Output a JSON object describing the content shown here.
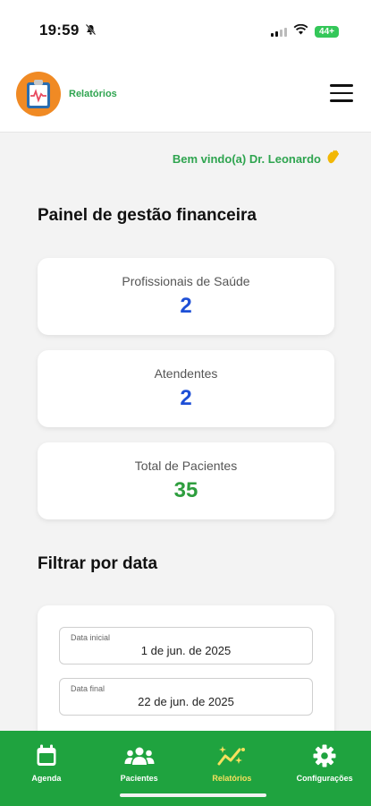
{
  "status_bar": {
    "time": "19:59",
    "battery": "44+"
  },
  "header": {
    "title": "Relatórios",
    "logo_icon": "clipboard-heartbeat-icon",
    "menu_icon": "hamburger-menu-icon"
  },
  "welcome": {
    "text": "Bem vindo(a) Dr. Leonardo",
    "icon": "waving-hand-icon"
  },
  "dashboard": {
    "title": "Painel de gestão financeira",
    "stats": [
      {
        "label": "Profissionais de Saúde",
        "value": "2",
        "color": "#1e4fd6"
      },
      {
        "label": "Atendentes",
        "value": "2",
        "color": "#1e4fd6"
      },
      {
        "label": "Total de Pacientes",
        "value": "35",
        "color": "#2e9e3e"
      }
    ]
  },
  "filter": {
    "title": "Filtrar por data",
    "start_label": "Data inicial",
    "start_value": "1 de jun. de 2025",
    "end_label": "Data final",
    "end_value": "22 de jun. de 2025"
  },
  "bottom_nav": {
    "active_color": "#f6e05e",
    "background": "#1fa33f",
    "items": [
      {
        "label": "Agenda",
        "icon": "calendar-icon"
      },
      {
        "label": "Pacientes",
        "icon": "people-icon"
      },
      {
        "label": "Relatórios",
        "icon": "chart-sparkle-icon",
        "active": true
      },
      {
        "label": "Configurações",
        "icon": "gear-icon"
      }
    ]
  }
}
